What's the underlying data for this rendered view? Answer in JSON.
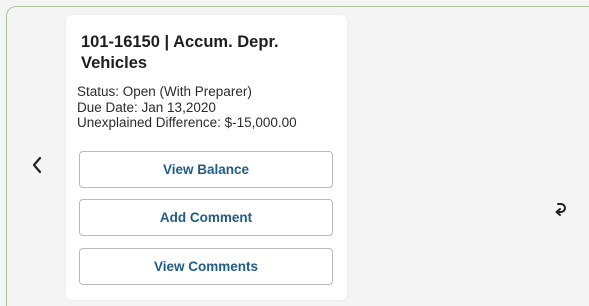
{
  "card": {
    "title": "101-16150 | Accum. Depr. Vehicles",
    "status": "Status: Open (With Preparer)",
    "due_date": "Due Date: Jan 13,2020",
    "unexplained_difference": "Unexplained Difference: $-15,000.00"
  },
  "actions": {
    "view_balance": "View Balance",
    "add_comment": "Add Comment",
    "view_comments": "View Comments"
  },
  "icons": {
    "previous": "chevron-left-icon",
    "return": "return-arrow-icon"
  },
  "colors": {
    "frame_border": "#a9c597",
    "button_text": "#1f5c86",
    "card_background": "#ffffff",
    "page_background": "#f4f4f4"
  }
}
